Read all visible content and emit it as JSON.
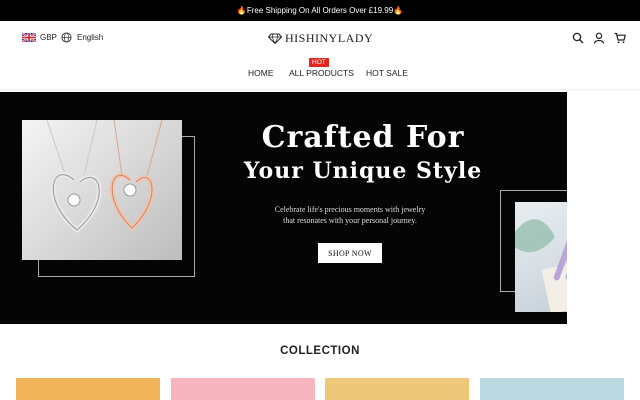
{
  "announcement": {
    "text": "Free Shipping On All Orders Over £19.99"
  },
  "header": {
    "currency": "GBP",
    "language": "English",
    "logo_text": "HISHINYLADY",
    "icons": [
      "search-icon",
      "account-icon",
      "cart-icon"
    ]
  },
  "nav": {
    "items": [
      "HOME",
      "ALL PRODUCTS",
      "HOT SALE"
    ],
    "badge": "HOT"
  },
  "banner": {
    "headline_line1": "Crafted For",
    "headline_line2": "Your Unique Style",
    "subtext_line1": "Celebrate life's precious moments with jewelry",
    "subtext_line2": "that resonates with your personal journey.",
    "button_label": "SHOP NOW"
  },
  "collection": {
    "title": "COLLECTION",
    "tile_colors": [
      "#f2b45a",
      "#f6b6c0",
      "#eec878",
      "#bcd8e0"
    ]
  },
  "colors": {
    "accent": "#e3261e",
    "banner_bg": "#050505",
    "flame": "#ff5a1f"
  }
}
